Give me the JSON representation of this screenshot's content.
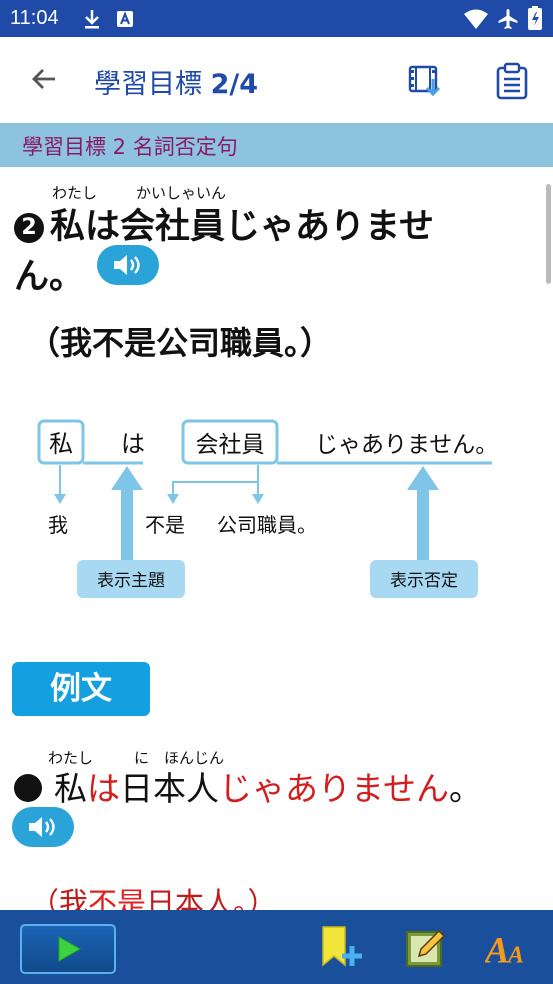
{
  "status": {
    "time": "11:04"
  },
  "appbar": {
    "title_prefix": "學習目標",
    "title_number": "2/4"
  },
  "section": {
    "label": "學習目標 2 名詞否定句"
  },
  "lesson": {
    "number_badge": "2",
    "ruby_watashi": "わたし",
    "ruby_kaishain": "かいしゃいん",
    "sentence_line1": "私は会社員じゃありませ",
    "sentence_line2": "ん。",
    "translation": "（我不是公司職員。）"
  },
  "diagram": {
    "box1": "私",
    "particle": "は",
    "box2": "会社員",
    "ending": "じゃありません。",
    "cn1": "我",
    "cn2": "不是",
    "cn3": "公司職員。",
    "label_topic": "表示主題",
    "label_negation": "表示否定"
  },
  "example": {
    "tag": "例文",
    "ruby_watashi": "わたし",
    "ruby_ni": "に",
    "ruby_honjin": "ほんじん",
    "word1": "私",
    "particle": "は",
    "word2": "日本人",
    "ending": "じゃありません",
    "period": "。",
    "translation_open": "（我",
    "translation_neg": "不是",
    "translation_rest": "日本人。）"
  },
  "colors": {
    "status_bar": "#1f4aa8",
    "title_blue": "#1f4aa8",
    "section_bg": "#8ec3e0",
    "section_text": "#8a1a66",
    "audio_button": "#29a3d8",
    "example_tag": "#14a0e0",
    "highlight_red": "#d21e1e",
    "bottom_bar": "#1a4f9c"
  },
  "icons": {
    "download": "download-icon",
    "notification": "app-notification-icon",
    "wifi": "wifi-icon",
    "airplane": "airplane-mode-icon",
    "battery": "battery-icon",
    "back": "back-arrow-icon",
    "film_download": "film-download-icon",
    "clipboard": "clipboard-icon",
    "speaker": "speaker-icon",
    "play": "play-icon",
    "bookmark_add": "bookmark-add-icon",
    "note_edit": "note-edit-icon",
    "font_size": "font-size-icon"
  }
}
